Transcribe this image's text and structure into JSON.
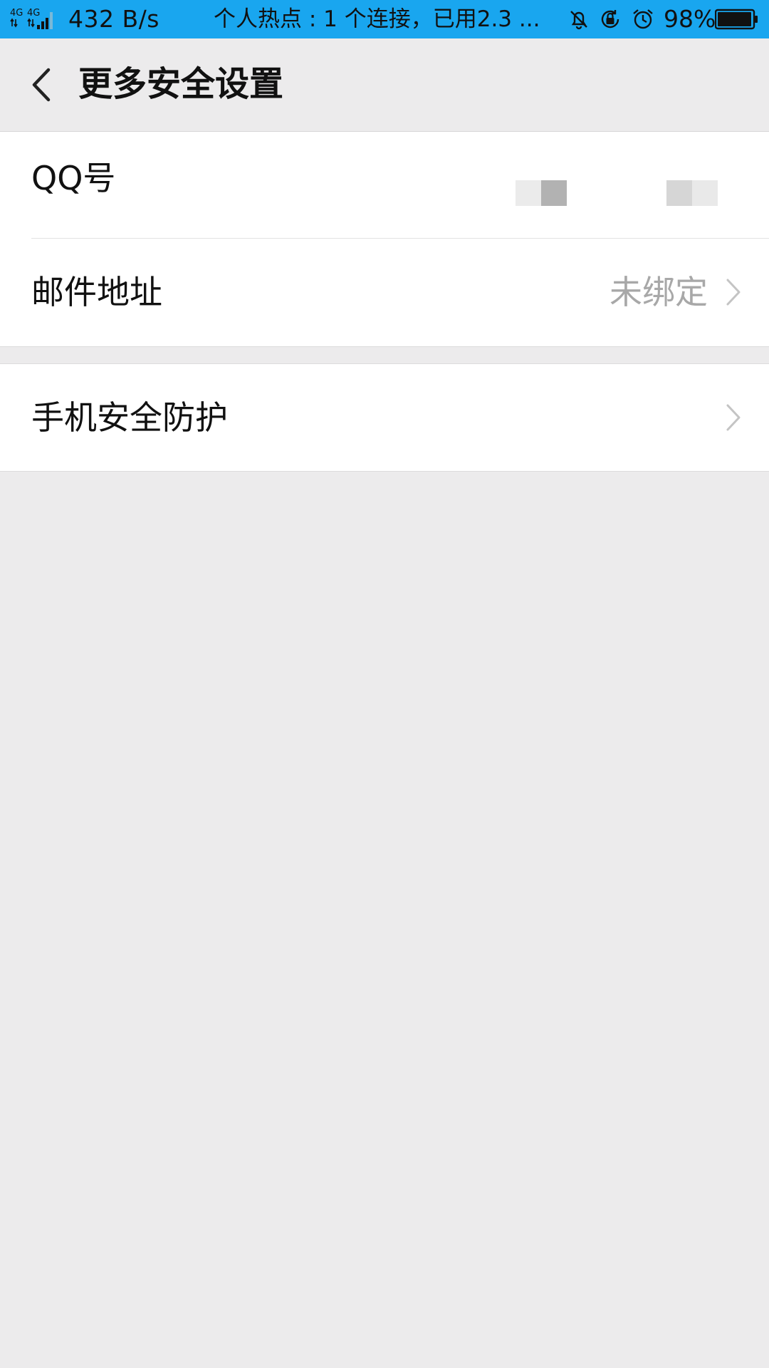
{
  "status_bar": {
    "network_type_1": "4G",
    "network_type_2": "4G",
    "speed": "432 B/s",
    "hotspot_text": "个人热点 : 1 个连接，已用2.3 ...",
    "battery_percent": "98%",
    "battery_level": 0.98,
    "icons": [
      "signal-icon",
      "bell-off-icon",
      "rotation-lock-icon",
      "alarm-icon",
      "battery-icon"
    ]
  },
  "header": {
    "title": "更多安全设置",
    "back_icon": "chevron-left-icon"
  },
  "settings": {
    "qq_number": {
      "label": "QQ号"
    },
    "email": {
      "label": "邮件地址",
      "value": "未绑定"
    },
    "phone_security": {
      "label": "手机安全防护"
    }
  },
  "colors": {
    "status_bar_bg": "#19a6ef",
    "page_bg": "#ecebec",
    "row_bg": "#ffffff",
    "secondary_text": "#a8a8a8"
  }
}
